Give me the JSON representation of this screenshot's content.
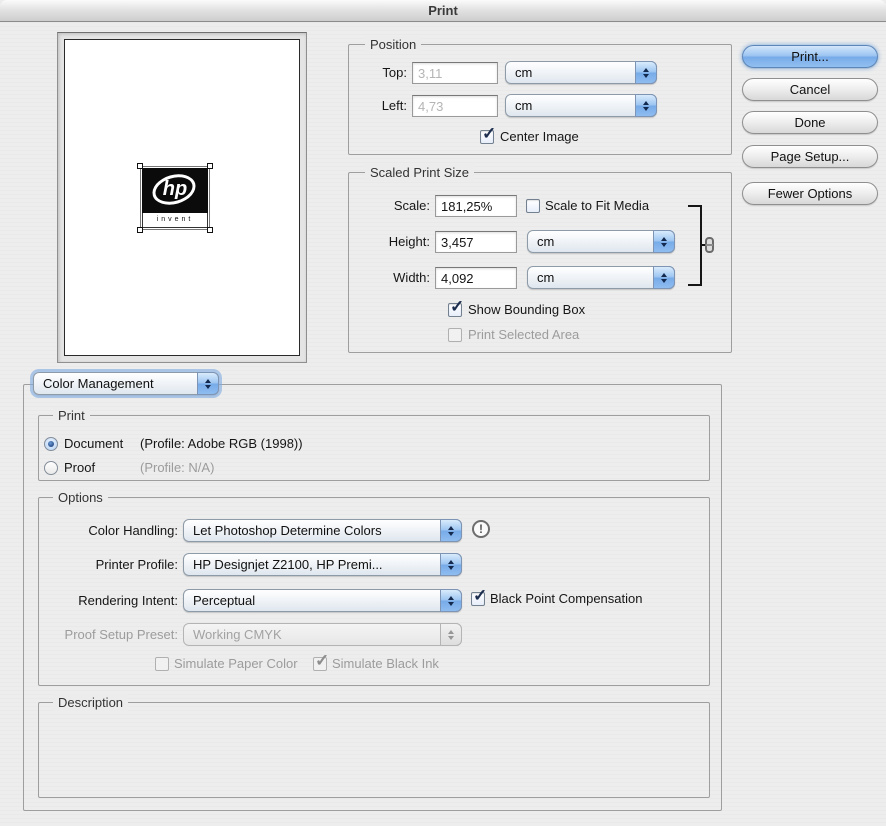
{
  "window": {
    "title": "Print",
    "background_color": "#ececec",
    "accent_color": "#77abe8"
  },
  "preview": {
    "logo": {
      "top_text": "hp",
      "bottom_text": "invent"
    }
  },
  "position": {
    "legend": "Position",
    "top_label": "Top:",
    "top_value": "3,11",
    "top_unit": "cm",
    "left_label": "Left:",
    "left_value": "4,73",
    "left_unit": "cm",
    "fields_enabled": false,
    "center_image_label": "Center Image",
    "center_image_checked": true
  },
  "scaled_print_size": {
    "legend": "Scaled Print Size",
    "scale_label": "Scale:",
    "scale_value": "181,25%",
    "scale_to_fit_label": "Scale to Fit Media",
    "scale_to_fit_checked": false,
    "height_label": "Height:",
    "height_value": "3,457",
    "height_unit": "cm",
    "width_label": "Width:",
    "width_value": "4,092",
    "width_unit": "cm",
    "show_bounding_box_label": "Show Bounding Box",
    "show_bounding_box_checked": true,
    "print_selected_area_label": "Print Selected Area",
    "print_selected_area_checked": false,
    "print_selected_area_enabled": false
  },
  "action_buttons": {
    "print": "Print...",
    "cancel": "Cancel",
    "done": "Done",
    "page_setup": "Page Setup...",
    "fewer_options": "Fewer Options"
  },
  "section_popup": {
    "value": "Color Management"
  },
  "print_section": {
    "legend": "Print",
    "document_label": "Document",
    "document_profile": "(Profile: Adobe RGB (1998))",
    "document_selected": true,
    "proof_label": "Proof",
    "proof_profile": "(Profile: N/A)",
    "proof_selected": false
  },
  "options_section": {
    "legend": "Options",
    "color_handling_label": "Color Handling:",
    "color_handling_value": "Let Photoshop Determine Colors",
    "printer_profile_label": "Printer Profile:",
    "printer_profile_value": "HP Designjet Z2100, HP Premi...",
    "rendering_intent_label": "Rendering Intent:",
    "rendering_intent_value": "Perceptual",
    "black_point_label": "Black Point Compensation",
    "black_point_checked": true,
    "proof_setup_label": "Proof Setup Preset:",
    "proof_setup_value": "Working CMYK",
    "proof_setup_enabled": false,
    "simulate_paper_label": "Simulate Paper Color",
    "simulate_paper_checked": false,
    "simulate_ink_label": "Simulate Black Ink",
    "simulate_ink_checked": true
  },
  "description_section": {
    "legend": "Description",
    "content": ""
  },
  "icons": {
    "info_glyph": "!"
  }
}
